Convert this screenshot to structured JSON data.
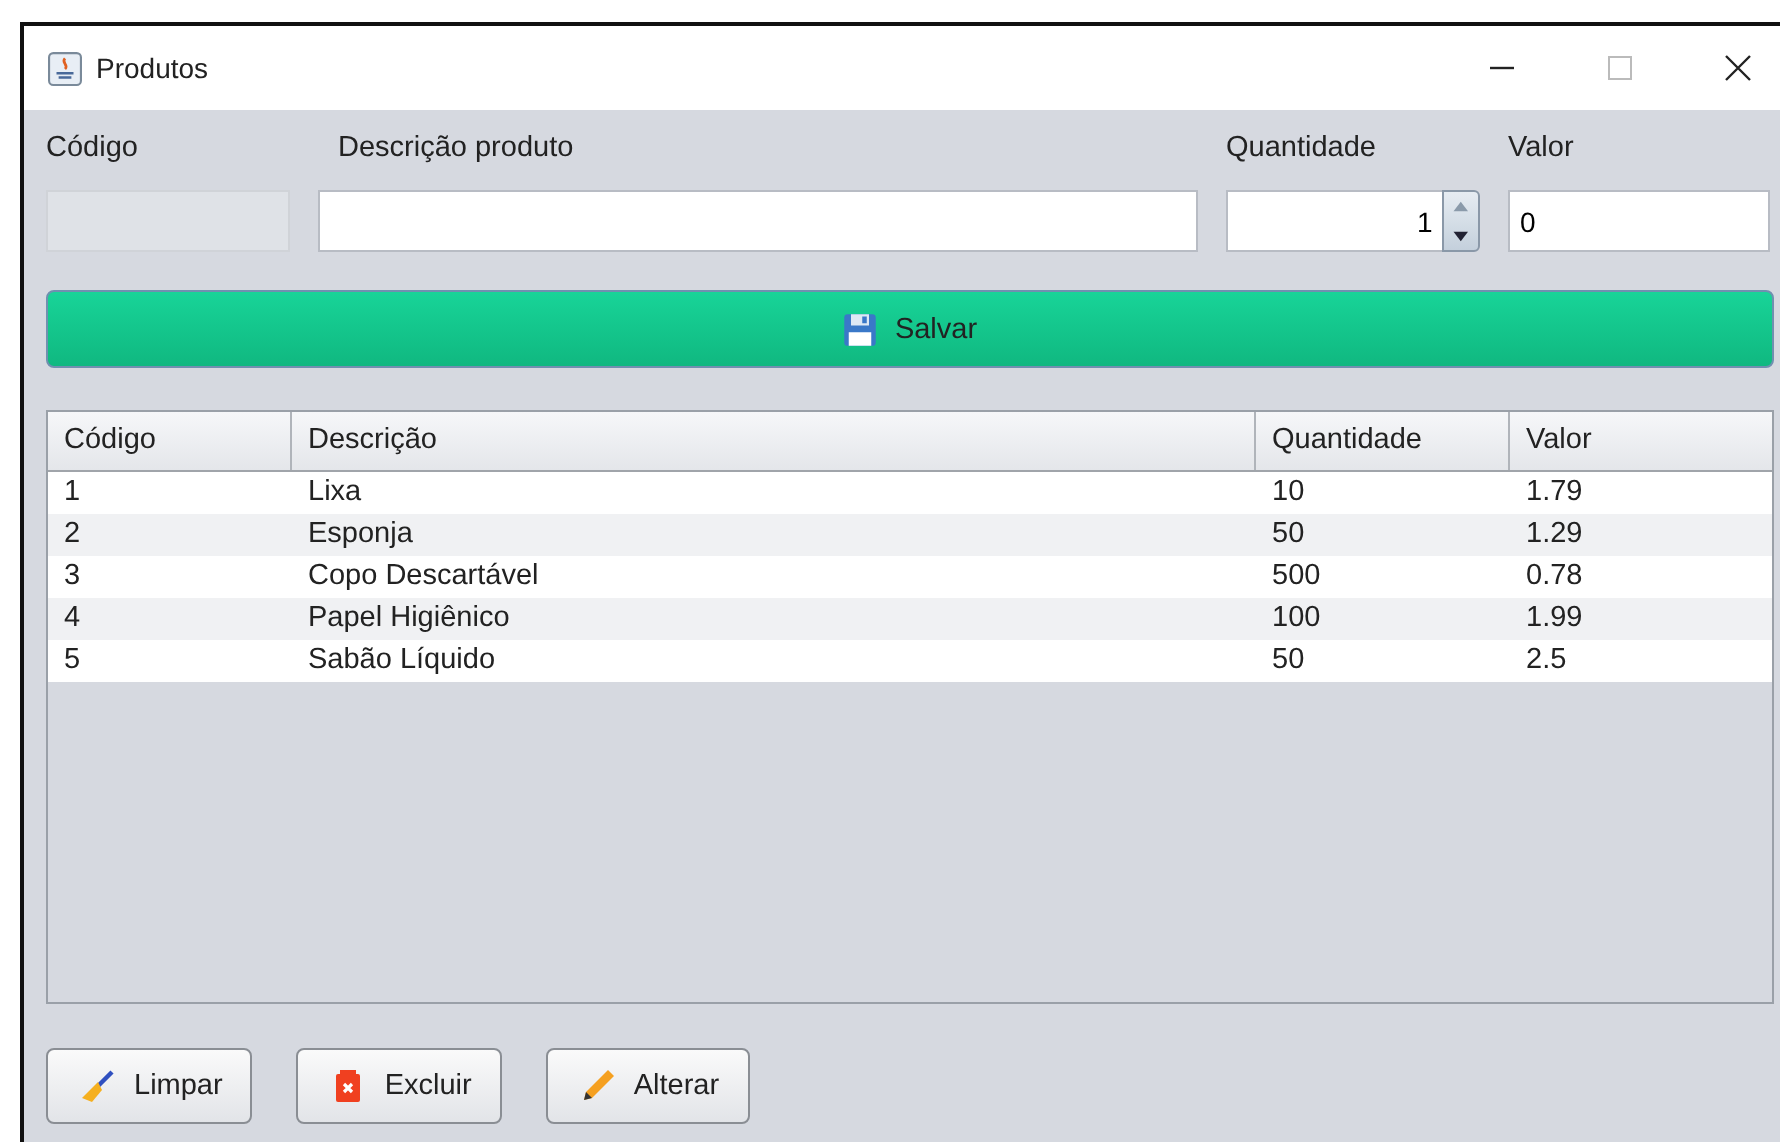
{
  "window": {
    "title": "Produtos"
  },
  "form": {
    "fields": [
      {
        "kind": "readonly",
        "label": "Código"
      },
      {
        "kind": "text",
        "label": "Descrição produto"
      },
      {
        "kind": "spinner",
        "label": "Quantidade",
        "value": "1"
      },
      {
        "kind": "text",
        "label": "Valor",
        "value": "0"
      }
    ]
  },
  "save_button": "Salvar",
  "table": {
    "columns": [
      "Código",
      "Descrição",
      "Quantidade",
      "Valor"
    ],
    "rows": [
      [
        "1",
        "Lixa",
        "10",
        "1.79"
      ],
      [
        "2",
        "Esponja",
        "50",
        "1.29"
      ],
      [
        "3",
        "Copo Descartável",
        "500",
        "0.78"
      ],
      [
        "4",
        "Papel Higiênico",
        "100",
        "1.99"
      ],
      [
        "5",
        "Sabão Líquido",
        "50",
        "2.5"
      ]
    ]
  },
  "buttons": [
    {
      "kind": "clear",
      "label": "Limpar"
    },
    {
      "kind": "delete",
      "label": "Excluir"
    },
    {
      "kind": "edit",
      "label": "Alterar"
    }
  ]
}
